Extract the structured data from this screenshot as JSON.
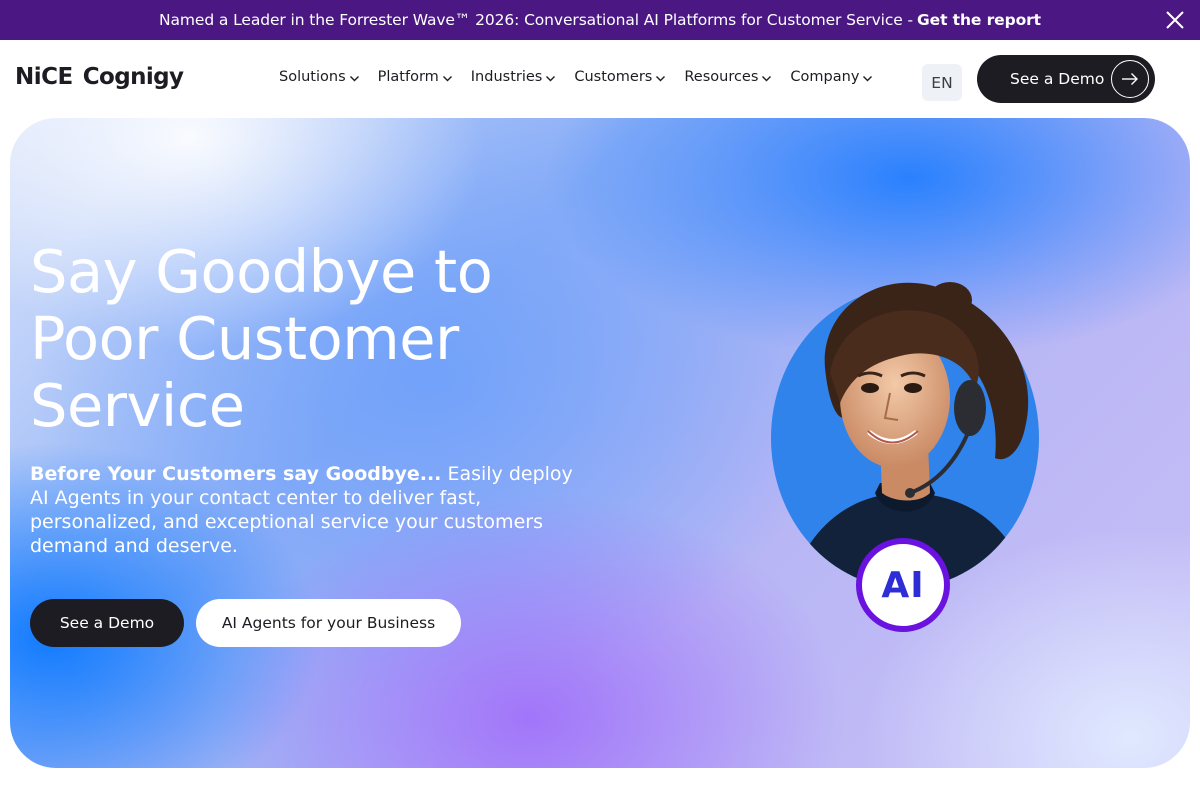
{
  "announcement": {
    "text": "Named a Leader in the Forrester Wave™ 2026: Conversational AI Platforms for Customer Service -",
    "cta": "Get the report",
    "close_icon": "close-icon",
    "background": "#4a1783"
  },
  "header": {
    "logo": {
      "brand": "NiCE",
      "product": "Cognigy"
    },
    "nav": [
      {
        "label": "Solutions",
        "icon": "chevron-down-icon"
      },
      {
        "label": "Platform",
        "icon": "chevron-down-icon"
      },
      {
        "label": "Industries",
        "icon": "chevron-down-icon"
      },
      {
        "label": "Customers",
        "icon": "chevron-down-icon"
      },
      {
        "label": "Resources",
        "icon": "chevron-down-icon"
      },
      {
        "label": "Company",
        "icon": "chevron-down-icon"
      }
    ],
    "language": "EN",
    "demo_button": {
      "label": "See a Demo",
      "icon": "arrow-right-icon"
    }
  },
  "hero": {
    "title": "Say Goodbye to Poor Customer Service",
    "subtitle_lead": "Before Your Customers say Goodbye...",
    "subtitle_rest": " Easily deploy AI Agents in your contact center to deliver fast, personalized, and exceptional service your customers demand and deserve.",
    "primary_button": "See a Demo",
    "secondary_button": "AI Agents for your Business",
    "badge": "AI"
  },
  "colors": {
    "dark": "#1d1c22",
    "accent_purple": "#6a12e0",
    "badge_text": "#2f2dd6"
  }
}
